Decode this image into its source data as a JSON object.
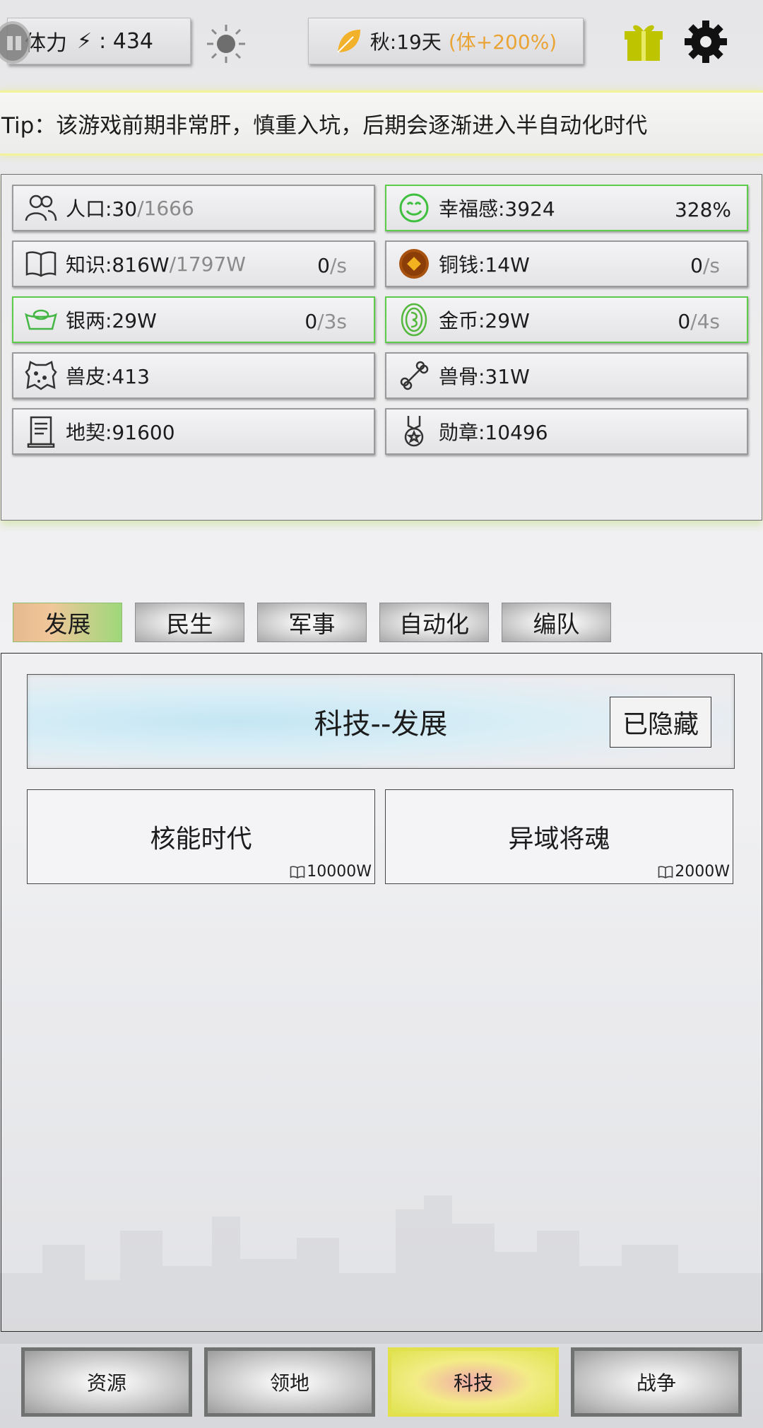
{
  "top_bar": {
    "stamina_label": "体力",
    "stamina_value": "434",
    "season_text": "秋:19天",
    "season_bonus": "(体+200%)",
    "gift_color": "#bfc400"
  },
  "tip": "Tip：该游戏前期非常肝，慎重入坑，后期会逐渐进入半自动化时代",
  "resources": [
    {
      "name": "人口:30",
      "max": "/1666",
      "rate": "",
      "rate_unit": "",
      "pct": "",
      "icon": "people-icon"
    },
    {
      "name": "幸福感:3924",
      "max": "",
      "rate": "",
      "rate_unit": "",
      "pct": "328%",
      "icon": "smiley-icon"
    },
    {
      "name": "知识:816W",
      "max": "/1797W",
      "rate": "0",
      "rate_unit": "/s",
      "pct": "",
      "icon": "book-icon"
    },
    {
      "name": "铜钱:14W",
      "max": "",
      "rate": "0",
      "rate_unit": "/s",
      "pct": "",
      "icon": "copper-coin-icon"
    },
    {
      "name": "银两:29W",
      "max": "",
      "rate": "0",
      "rate_unit": "/3s",
      "pct": "",
      "icon": "silver-ingot-icon"
    },
    {
      "name": "金币:29W",
      "max": "",
      "rate": "0",
      "rate_unit": "/4s",
      "pct": "",
      "icon": "gold-coin-icon"
    },
    {
      "name": "兽皮:413",
      "max": "",
      "rate": "",
      "rate_unit": "",
      "pct": "",
      "icon": "hide-icon"
    },
    {
      "name": "兽骨:31W",
      "max": "",
      "rate": "",
      "rate_unit": "",
      "pct": "",
      "icon": "bone-icon"
    },
    {
      "name": "地契:91600",
      "max": "",
      "rate": "",
      "rate_unit": "",
      "pct": "",
      "icon": "deed-icon"
    },
    {
      "name": "勋章:10496",
      "max": "",
      "rate": "",
      "rate_unit": "",
      "pct": "",
      "icon": "medal-icon"
    }
  ],
  "tabs": [
    "发展",
    "民生",
    "军事",
    "自动化",
    "编队"
  ],
  "section": {
    "title": "科技--发展",
    "hide_label": "已隐藏"
  },
  "techs": [
    {
      "name": "核能时代",
      "cost": "10000W"
    },
    {
      "name": "异域将魂",
      "cost": "2000W"
    }
  ],
  "nav": [
    "资源",
    "领地",
    "科技",
    "战争"
  ]
}
